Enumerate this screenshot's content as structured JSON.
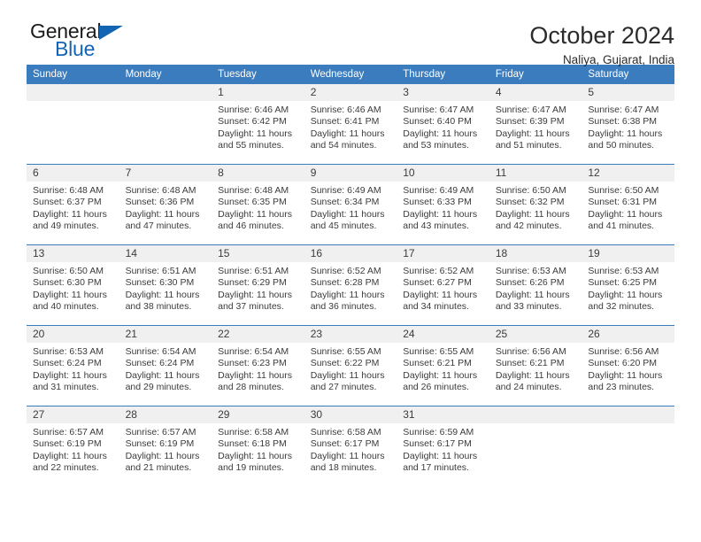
{
  "brand": {
    "name_top": "General",
    "name_bottom": "Blue",
    "accent_color": "#1464b4",
    "triangle_icon": "triangle-icon"
  },
  "header": {
    "title": "October 2024",
    "subtitle": "Naliya, Gujarat, India"
  },
  "calendar": {
    "header_color": "#3b7cbe",
    "daynum_bg": "#f0f0f0",
    "weekdays": [
      "Sunday",
      "Monday",
      "Tuesday",
      "Wednesday",
      "Thursday",
      "Friday",
      "Saturday"
    ],
    "weeks": [
      [
        {
          "day": "",
          "sunrise": "",
          "sunset": "",
          "daylight1": "",
          "daylight2": ""
        },
        {
          "day": "",
          "sunrise": "",
          "sunset": "",
          "daylight1": "",
          "daylight2": ""
        },
        {
          "day": "1",
          "sunrise": "Sunrise: 6:46 AM",
          "sunset": "Sunset: 6:42 PM",
          "daylight1": "Daylight: 11 hours",
          "daylight2": "and 55 minutes."
        },
        {
          "day": "2",
          "sunrise": "Sunrise: 6:46 AM",
          "sunset": "Sunset: 6:41 PM",
          "daylight1": "Daylight: 11 hours",
          "daylight2": "and 54 minutes."
        },
        {
          "day": "3",
          "sunrise": "Sunrise: 6:47 AM",
          "sunset": "Sunset: 6:40 PM",
          "daylight1": "Daylight: 11 hours",
          "daylight2": "and 53 minutes."
        },
        {
          "day": "4",
          "sunrise": "Sunrise: 6:47 AM",
          "sunset": "Sunset: 6:39 PM",
          "daylight1": "Daylight: 11 hours",
          "daylight2": "and 51 minutes."
        },
        {
          "day": "5",
          "sunrise": "Sunrise: 6:47 AM",
          "sunset": "Sunset: 6:38 PM",
          "daylight1": "Daylight: 11 hours",
          "daylight2": "and 50 minutes."
        }
      ],
      [
        {
          "day": "6",
          "sunrise": "Sunrise: 6:48 AM",
          "sunset": "Sunset: 6:37 PM",
          "daylight1": "Daylight: 11 hours",
          "daylight2": "and 49 minutes."
        },
        {
          "day": "7",
          "sunrise": "Sunrise: 6:48 AM",
          "sunset": "Sunset: 6:36 PM",
          "daylight1": "Daylight: 11 hours",
          "daylight2": "and 47 minutes."
        },
        {
          "day": "8",
          "sunrise": "Sunrise: 6:48 AM",
          "sunset": "Sunset: 6:35 PM",
          "daylight1": "Daylight: 11 hours",
          "daylight2": "and 46 minutes."
        },
        {
          "day": "9",
          "sunrise": "Sunrise: 6:49 AM",
          "sunset": "Sunset: 6:34 PM",
          "daylight1": "Daylight: 11 hours",
          "daylight2": "and 45 minutes."
        },
        {
          "day": "10",
          "sunrise": "Sunrise: 6:49 AM",
          "sunset": "Sunset: 6:33 PM",
          "daylight1": "Daylight: 11 hours",
          "daylight2": "and 43 minutes."
        },
        {
          "day": "11",
          "sunrise": "Sunrise: 6:50 AM",
          "sunset": "Sunset: 6:32 PM",
          "daylight1": "Daylight: 11 hours",
          "daylight2": "and 42 minutes."
        },
        {
          "day": "12",
          "sunrise": "Sunrise: 6:50 AM",
          "sunset": "Sunset: 6:31 PM",
          "daylight1": "Daylight: 11 hours",
          "daylight2": "and 41 minutes."
        }
      ],
      [
        {
          "day": "13",
          "sunrise": "Sunrise: 6:50 AM",
          "sunset": "Sunset: 6:30 PM",
          "daylight1": "Daylight: 11 hours",
          "daylight2": "and 40 minutes."
        },
        {
          "day": "14",
          "sunrise": "Sunrise: 6:51 AM",
          "sunset": "Sunset: 6:30 PM",
          "daylight1": "Daylight: 11 hours",
          "daylight2": "and 38 minutes."
        },
        {
          "day": "15",
          "sunrise": "Sunrise: 6:51 AM",
          "sunset": "Sunset: 6:29 PM",
          "daylight1": "Daylight: 11 hours",
          "daylight2": "and 37 minutes."
        },
        {
          "day": "16",
          "sunrise": "Sunrise: 6:52 AM",
          "sunset": "Sunset: 6:28 PM",
          "daylight1": "Daylight: 11 hours",
          "daylight2": "and 36 minutes."
        },
        {
          "day": "17",
          "sunrise": "Sunrise: 6:52 AM",
          "sunset": "Sunset: 6:27 PM",
          "daylight1": "Daylight: 11 hours",
          "daylight2": "and 34 minutes."
        },
        {
          "day": "18",
          "sunrise": "Sunrise: 6:53 AM",
          "sunset": "Sunset: 6:26 PM",
          "daylight1": "Daylight: 11 hours",
          "daylight2": "and 33 minutes."
        },
        {
          "day": "19",
          "sunrise": "Sunrise: 6:53 AM",
          "sunset": "Sunset: 6:25 PM",
          "daylight1": "Daylight: 11 hours",
          "daylight2": "and 32 minutes."
        }
      ],
      [
        {
          "day": "20",
          "sunrise": "Sunrise: 6:53 AM",
          "sunset": "Sunset: 6:24 PM",
          "daylight1": "Daylight: 11 hours",
          "daylight2": "and 31 minutes."
        },
        {
          "day": "21",
          "sunrise": "Sunrise: 6:54 AM",
          "sunset": "Sunset: 6:24 PM",
          "daylight1": "Daylight: 11 hours",
          "daylight2": "and 29 minutes."
        },
        {
          "day": "22",
          "sunrise": "Sunrise: 6:54 AM",
          "sunset": "Sunset: 6:23 PM",
          "daylight1": "Daylight: 11 hours",
          "daylight2": "and 28 minutes."
        },
        {
          "day": "23",
          "sunrise": "Sunrise: 6:55 AM",
          "sunset": "Sunset: 6:22 PM",
          "daylight1": "Daylight: 11 hours",
          "daylight2": "and 27 minutes."
        },
        {
          "day": "24",
          "sunrise": "Sunrise: 6:55 AM",
          "sunset": "Sunset: 6:21 PM",
          "daylight1": "Daylight: 11 hours",
          "daylight2": "and 26 minutes."
        },
        {
          "day": "25",
          "sunrise": "Sunrise: 6:56 AM",
          "sunset": "Sunset: 6:21 PM",
          "daylight1": "Daylight: 11 hours",
          "daylight2": "and 24 minutes."
        },
        {
          "day": "26",
          "sunrise": "Sunrise: 6:56 AM",
          "sunset": "Sunset: 6:20 PM",
          "daylight1": "Daylight: 11 hours",
          "daylight2": "and 23 minutes."
        }
      ],
      [
        {
          "day": "27",
          "sunrise": "Sunrise: 6:57 AM",
          "sunset": "Sunset: 6:19 PM",
          "daylight1": "Daylight: 11 hours",
          "daylight2": "and 22 minutes."
        },
        {
          "day": "28",
          "sunrise": "Sunrise: 6:57 AM",
          "sunset": "Sunset: 6:19 PM",
          "daylight1": "Daylight: 11 hours",
          "daylight2": "and 21 minutes."
        },
        {
          "day": "29",
          "sunrise": "Sunrise: 6:58 AM",
          "sunset": "Sunset: 6:18 PM",
          "daylight1": "Daylight: 11 hours",
          "daylight2": "and 19 minutes."
        },
        {
          "day": "30",
          "sunrise": "Sunrise: 6:58 AM",
          "sunset": "Sunset: 6:17 PM",
          "daylight1": "Daylight: 11 hours",
          "daylight2": "and 18 minutes."
        },
        {
          "day": "31",
          "sunrise": "Sunrise: 6:59 AM",
          "sunset": "Sunset: 6:17 PM",
          "daylight1": "Daylight: 11 hours",
          "daylight2": "and 17 minutes."
        },
        {
          "day": "",
          "sunrise": "",
          "sunset": "",
          "daylight1": "",
          "daylight2": ""
        },
        {
          "day": "",
          "sunrise": "",
          "sunset": "",
          "daylight1": "",
          "daylight2": ""
        }
      ]
    ]
  }
}
